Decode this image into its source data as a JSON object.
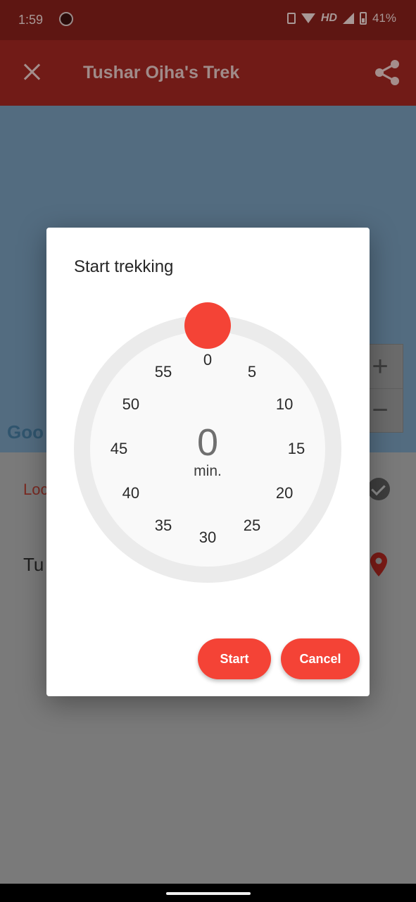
{
  "status_bar": {
    "time": "1:59",
    "network": "HD",
    "battery": "41%"
  },
  "app_bar": {
    "title": "Tushar Ojha's Trek",
    "close_icon": "close-icon",
    "share_icon": "share-icon"
  },
  "map": {
    "zoom_in": "+",
    "zoom_out": "−",
    "attribution": "Goo"
  },
  "content": {
    "location_label": "Loc",
    "name_label": "Tu"
  },
  "dialog": {
    "title": "Start trekking",
    "dial_numbers": [
      "0",
      "5",
      "10",
      "15",
      "20",
      "25",
      "30",
      "35",
      "40",
      "45",
      "50",
      "55"
    ],
    "value": "0",
    "unit": "min.",
    "start_label": "Start",
    "cancel_label": "Cancel"
  },
  "colors": {
    "accent": "#f44336",
    "app_bar_dimmed": "#711b17",
    "map_dimmed": "#536c80"
  }
}
